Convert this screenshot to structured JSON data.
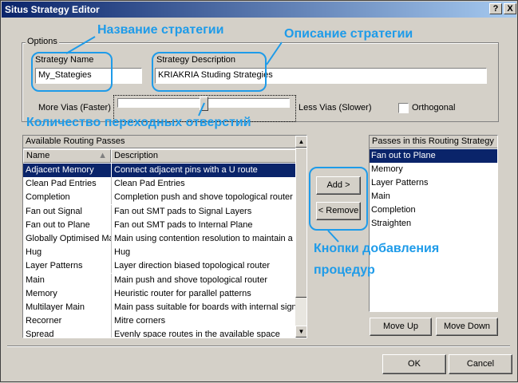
{
  "window": {
    "title": "Situs Strategy Editor",
    "help_label": "?",
    "close_label": "X"
  },
  "options": {
    "legend": "Options",
    "strategy_name_label": "Strategy Name",
    "strategy_name_value": "My_Stategies",
    "strategy_desc_label": "Strategy Description",
    "strategy_desc_value": "KRIAKRIA Studing Strategies",
    "more_vias_label": "More Vias (Faster)",
    "less_vias_label": "Less Vias (Slower)",
    "via_slider_level": 0.5,
    "orthogonal_label": "Orthogonal",
    "orthogonal_checked": false
  },
  "available": {
    "header": "Available Routing Passes",
    "col_name": "Name",
    "col_desc": "Description",
    "rows": [
      {
        "name": "Adjacent Memory",
        "desc": "Connect adjacent pins with a U route",
        "selected": true
      },
      {
        "name": "Clean Pad Entries",
        "desc": "Clean Pad Entries"
      },
      {
        "name": "Completion",
        "desc": "Completion push and shove topological router"
      },
      {
        "name": "Fan out Signal",
        "desc": "Fan out SMT pads to Signal Layers"
      },
      {
        "name": "Fan out to Plane",
        "desc": "Fan out SMT pads to Internal Plane"
      },
      {
        "name": "Globally Optimised Main",
        "desc": "Main using contention resolution to maintain a gl"
      },
      {
        "name": "Hug",
        "desc": "Hug"
      },
      {
        "name": "Layer Patterns",
        "desc": "Layer direction biased topological router"
      },
      {
        "name": "Main",
        "desc": "Main push and shove topological router"
      },
      {
        "name": "Memory",
        "desc": "Heuristic router for parallel patterns"
      },
      {
        "name": "Multilayer Main",
        "desc": "Main pass suitable for boards with internal signal"
      },
      {
        "name": "Recorner",
        "desc": "Mitre corners"
      },
      {
        "name": "Spread",
        "desc": "Evenly space routes in the available space"
      }
    ]
  },
  "buttons": {
    "add": "Add >",
    "remove": "< Remove",
    "move_up": "Move Up",
    "move_down": "Move Down",
    "ok": "OK",
    "cancel": "Cancel"
  },
  "passes": {
    "header": "Passes in this Routing Strategy",
    "items": [
      "Fan out to Plane",
      "Memory",
      "Layer Patterns",
      "Main",
      "Completion",
      "Straighten"
    ],
    "selected_index": 0
  },
  "annotations": {
    "name": "Название стратегии",
    "desc": "Описание стратегии",
    "vias": "Количество переходных отверстий",
    "buttons_line1": "Кнопки добавления",
    "buttons_line2": "процедур"
  },
  "colors": {
    "annotation": "#1e9be9",
    "selection": "#0a246a",
    "title_start": "#0a246a"
  }
}
